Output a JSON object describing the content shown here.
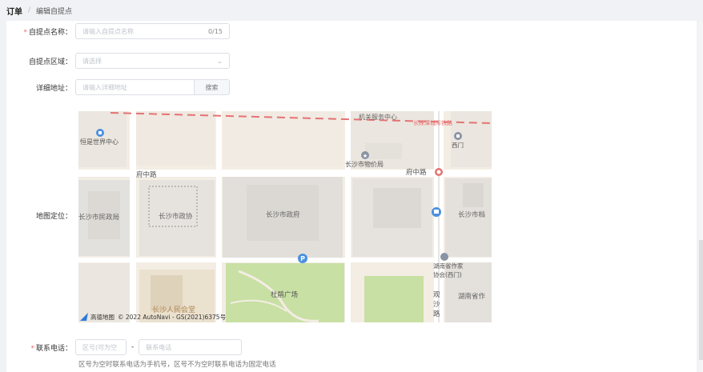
{
  "breadcrumb": {
    "root": "订单",
    "separator": "/",
    "current": "编辑自提点"
  },
  "form": {
    "name": {
      "label": "自提点名称：",
      "placeholder": "请输入自提点名称",
      "counter": "0/15"
    },
    "region": {
      "label": "自提点区域：",
      "placeholder": "请选择"
    },
    "address": {
      "label": "详细地址：",
      "placeholder": "请输入详细地址",
      "search_label": "搜索"
    },
    "map": {
      "label": "地图定位："
    },
    "phone": {
      "label": "联系电话：",
      "area_placeholder": "区号(可为空",
      "dash": "-",
      "number_placeholder": "联系电话",
      "hint": "区号为空时联系电话为手机号，区号不为空时联系电话为固定电话"
    }
  },
  "map_labels": {
    "poi_service": "机关服务中心",
    "rail": "长株潭城际铁路",
    "world_center": "恒是世界中心",
    "west_gate_top": "西门",
    "price_bureau": "长沙市物价局",
    "road_left": "府中路",
    "road_right": "府中路",
    "civil_affairs": "长沙市民政局",
    "cppcc": "长沙市政协",
    "city_gov": "长沙市政府",
    "archives": "长沙市档",
    "writers_assoc_1": "湖南省作家",
    "writers_assoc_2": "协会(西门)",
    "hunan_prov": "湖南省作",
    "square": "杜鹃广场",
    "road_v1": "观",
    "road_v2": "沙",
    "road_v3": "路",
    "hall": "长沙人民会堂",
    "copyright": "© 2022 AutoNavi - GS(2021)6375号",
    "brand": "高德地图",
    "parking": "P"
  },
  "colors": {
    "required": "#f56c6c",
    "map_bg": "#f3ede4",
    "map_green": "#c8e0a3",
    "map_block": "#e6e2dc",
    "rail": "#e57373"
  }
}
